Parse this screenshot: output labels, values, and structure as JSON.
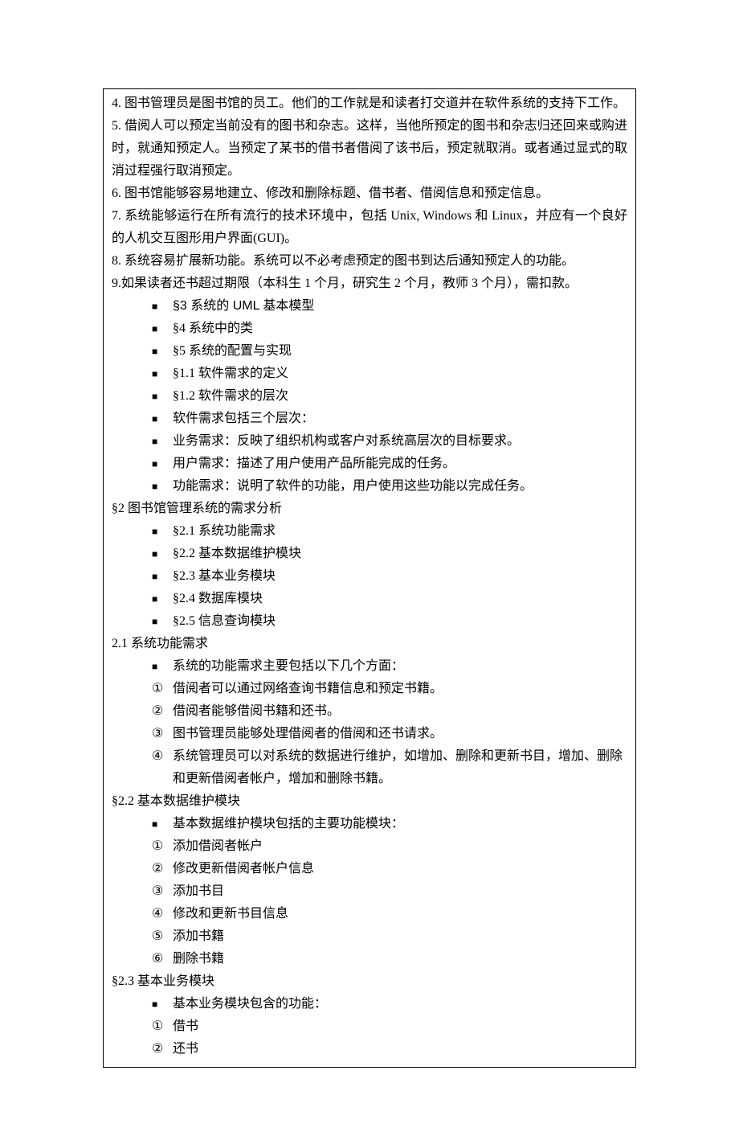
{
  "intro": {
    "p4": "4. 图书管理员是图书馆的员工。他们的工作就是和读者打交道并在软件系统的支持下工作。",
    "p5": "5. 借阅人可以预定当前没有的图书和杂志。这样，当他所预定的图书和杂志归还回来或购进时，就通知预定人。当预定了某书的借书者借阅了该书后，预定就取消。或者通过显式的取消过程强行取消预定。",
    "p6": "6. 图书馆能够容易地建立、修改和删除标题、借书者、借阅信息和预定信息。",
    "p7": "7. 系统能够运行在所有流行的技术环境中，包括 Unix, Windows 和  Linux，并应有一个良好的人机交互图形用户界面(GUI)。",
    "p8": "8. 系统容易扩展新功能。系统可以不必考虑预定的图书到达后通知预定人的功能。",
    "p9": "9.如果读者还书超过期限（本科生 1 个月，研究生 2 个月，教师 3 个月），需扣款。"
  },
  "toc1": {
    "blank": "",
    "s3": "§3   系统的 UML 基本模型",
    "s4": "§4   系统中的类",
    "s5": "§5   系统的配置与实现",
    "s1_1": "§1.1   软件需求的定义",
    "s1_2": "§1.2   软件需求的层次",
    "reqLevels": "软件需求包括三个层次：",
    "biz": "业务需求：反映了组织机构或客户对系统高层次的目标要求。",
    "user": "用户需求：描述了用户使用产品所能完成的任务。",
    "func": "功能需求：说明了软件的功能，用户使用这些功能以完成任务。"
  },
  "s2": {
    "heading": "§2   图书馆管理系统的需求分析",
    "i1": "§2.1   系统功能需求",
    "i2": "§2.2   基本数据维护模块",
    "i3": "§2.3   基本业务模块",
    "i4": "§2.4   数据库模块",
    "i5": "§2.5   信息查询模块"
  },
  "s2_1": {
    "heading": "2.1   系统功能需求",
    "lead": "系统的功能需求主要包括以下几个方面：",
    "n1": {
      "m": "①",
      "t": "借阅者可以通过网络查询书籍信息和预定书籍。"
    },
    "n2": {
      "m": "②",
      "t": "借阅者能够借阅书籍和还书。"
    },
    "n3": {
      "m": "③",
      "t": "图书管理员能够处理借阅者的借阅和还书请求。"
    },
    "n4": {
      "m": "④",
      "t": "系统管理员可以对系统的数据进行维护，如增加、删除和更新书目，增加、删除和更新借阅者帐户，增加和删除书籍。"
    }
  },
  "s2_2": {
    "heading": "§2.2   基本数据维护模块",
    "lead": "基本数据维护模块包括的主要功能模块：",
    "n1": {
      "m": "①",
      "t": "添加借阅者帐户"
    },
    "n2": {
      "m": "②",
      "t": "修改更新借阅者帐户信息"
    },
    "n3": {
      "m": "③",
      "t": "添加书目"
    },
    "n4": {
      "m": "④",
      "t": "修改和更新书目信息"
    },
    "n5": {
      "m": "⑤",
      "t": "添加书籍"
    },
    "n6": {
      "m": "⑥",
      "t": "删除书籍"
    }
  },
  "s2_3": {
    "heading": "§2.3   基本业务模块",
    "lead": "基本业务模块包含的功能：",
    "n1": {
      "m": "①",
      "t": "借书"
    },
    "n2": {
      "m": "②",
      "t": "还书"
    }
  }
}
